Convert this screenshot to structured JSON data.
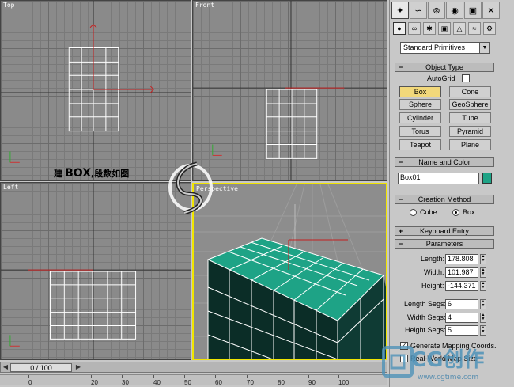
{
  "viewports": {
    "top": "Top",
    "front": "Front",
    "left": "Left",
    "perspective": "Perspective"
  },
  "annotation": {
    "prefix": "建",
    "main": "BOX",
    "suffix": ",段数如图"
  },
  "timeline": {
    "frame": "0 / 100",
    "ticks": [
      "0",
      "20",
      "30",
      "40",
      "50",
      "60",
      "70",
      "80",
      "90",
      "100"
    ]
  },
  "tabs": [
    {
      "icon": "create-icon"
    },
    {
      "icon": "modify-icon"
    },
    {
      "icon": "hierarchy-icon"
    },
    {
      "icon": "motion-icon"
    },
    {
      "icon": "display-icon"
    },
    {
      "icon": "utilities-icon"
    }
  ],
  "create_categories": [
    {
      "icon": "geometry-icon"
    },
    {
      "icon": "shapes-icon"
    },
    {
      "icon": "lights-icon"
    },
    {
      "icon": "cameras-icon"
    },
    {
      "icon": "helpers-icon"
    },
    {
      "icon": "spacewarps-icon"
    },
    {
      "icon": "systems-icon"
    }
  ],
  "category_dropdown": "Standard Primitives",
  "object_type": {
    "title": "Object Type",
    "autogrid": "AutoGrid",
    "buttons": [
      "Box",
      "Cone",
      "Sphere",
      "GeoSphere",
      "Cylinder",
      "Tube",
      "Torus",
      "Pyramid",
      "Teapot",
      "Plane"
    ],
    "active": "Box"
  },
  "name_color": {
    "title": "Name and Color",
    "name": "Box01",
    "color": "#1ea386"
  },
  "creation_method": {
    "title": "Creation Method",
    "options": [
      "Cube",
      "Box"
    ],
    "selected": "Box"
  },
  "keyboard_entry": {
    "title": "Keyboard Entry"
  },
  "parameters": {
    "title": "Parameters",
    "length_label": "Length:",
    "length": "178.808",
    "width_label": "Width:",
    "width": "101.987",
    "height_label": "Height:",
    "height": "-144.371",
    "length_segs_label": "Length Segs:",
    "length_segs": "6",
    "width_segs_label": "Width Segs:",
    "width_segs": "4",
    "height_segs_label": "Height Segs:",
    "height_segs": "5",
    "gen_mapping": "Generate Mapping Coords.",
    "real_world": "Real-World Map Size"
  },
  "colors": {
    "active_viewport": "#f1e500",
    "box_face": "#1ea386",
    "active_button": "#f2d87a"
  },
  "watermark": {
    "text": "CG创作",
    "url": "www.cgtime.com"
  }
}
